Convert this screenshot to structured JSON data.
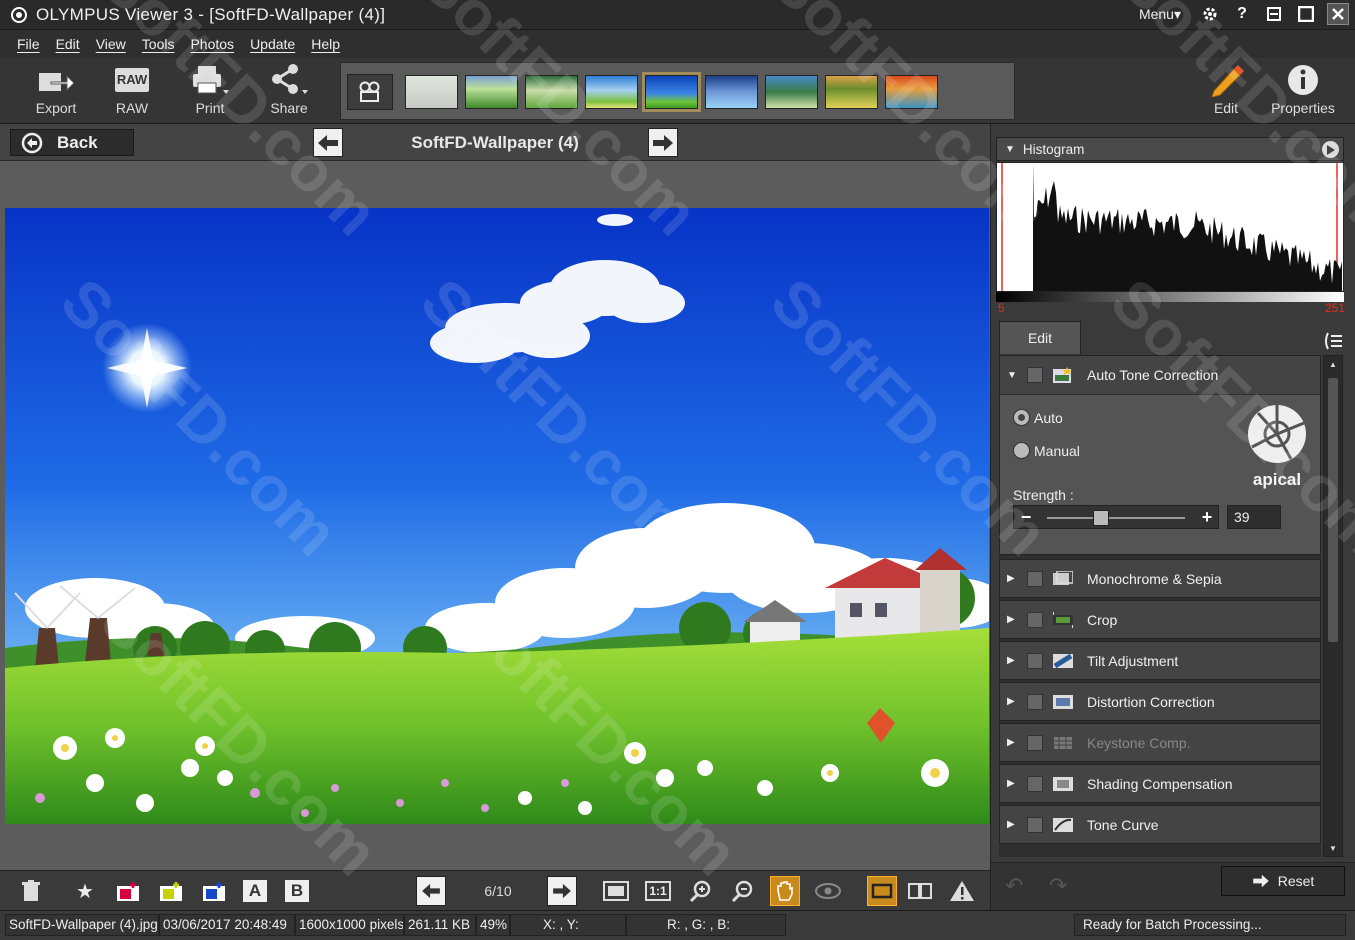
{
  "window": {
    "title": "OLYMPUS Viewer 3 - [SoftFD-Wallpaper (4)]",
    "menu_label": "Menu▾",
    "controls": [
      "settings-icon",
      "help-icon",
      "restore-icon",
      "maximize-icon",
      "close-icon"
    ]
  },
  "menubar": {
    "items": [
      "File",
      "Edit",
      "View",
      "Tools",
      "Photos",
      "Update",
      "Help"
    ]
  },
  "toolbar": {
    "export": "Export",
    "raw": "RAW",
    "print": "Print",
    "share": "Share",
    "edit": "Edit",
    "properties": "Properties",
    "raw_badge": "RAW"
  },
  "thumbnails": {
    "count": 9,
    "selected_index": 4
  },
  "navbar": {
    "back": "Back",
    "image_title": "SoftFD-Wallpaper (4)"
  },
  "bottombar": {
    "page": "6/10",
    "one_to_one": "1:1",
    "label_a": "A",
    "label_b": "B"
  },
  "statusbar": {
    "filename": "SoftFD-Wallpaper (4).jpg",
    "datetime": "03/06/2017 20:48:49",
    "dimensions": "1600x1000 pixels",
    "filesize": "261.11 KB",
    "zoom": "49%",
    "coords": "X: , Y:",
    "rgb": "R: , G: , B:",
    "message": "Ready for Batch Processing..."
  },
  "histogram": {
    "label": "Histogram",
    "min": "5",
    "max": "251"
  },
  "edit_panel": {
    "tab": "Edit",
    "auto_tone": {
      "label": "Auto Tone Correction",
      "auto": "Auto",
      "manual": "Manual",
      "selected": "Auto",
      "strength_label": "Strength :",
      "strength_value": "39",
      "slider_level": 0.39,
      "logo": "apical"
    },
    "sections": [
      {
        "label": "Monochrome & Sepia",
        "enabled": true
      },
      {
        "label": "Crop",
        "enabled": true
      },
      {
        "label": "Tilt Adjustment",
        "enabled": true
      },
      {
        "label": "Distortion Correction",
        "enabled": true
      },
      {
        "label": "Keystone Comp.",
        "enabled": false
      },
      {
        "label": "Shading Compensation",
        "enabled": true
      },
      {
        "label": "Tone Curve",
        "enabled": true
      }
    ],
    "reset": "Reset"
  },
  "watermark": "SoftFD.com",
  "colors": {
    "accent_orange": "#c88a1c",
    "selected_thumb": "#a08d5a",
    "histogram_marker": "#e03020"
  }
}
